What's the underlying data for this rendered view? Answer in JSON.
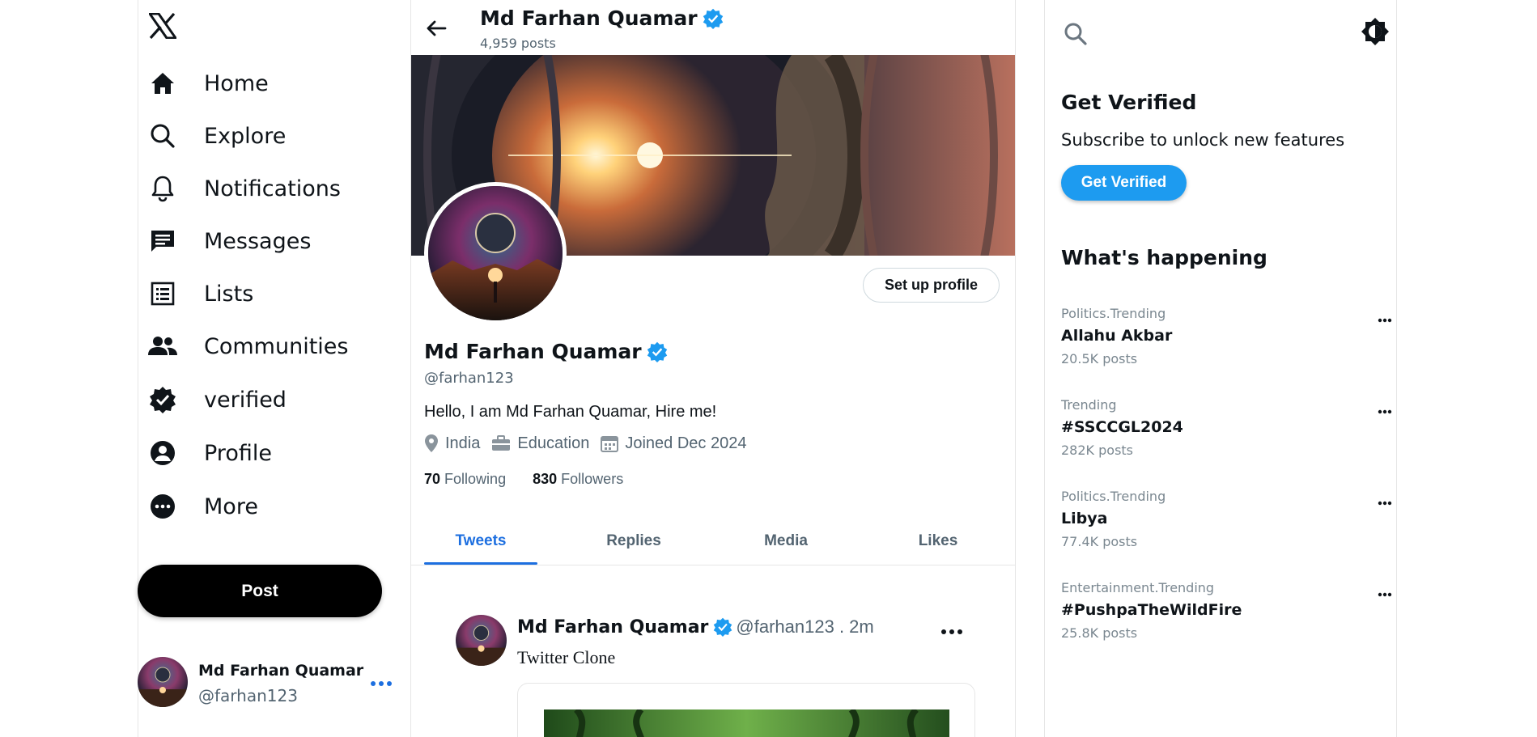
{
  "nav": {
    "items": [
      {
        "label": "Home",
        "icon": "home-icon"
      },
      {
        "label": "Explore",
        "icon": "search-icon"
      },
      {
        "label": "Notifications",
        "icon": "bell-icon"
      },
      {
        "label": "Messages",
        "icon": "message-icon"
      },
      {
        "label": "Lists",
        "icon": "list-icon"
      },
      {
        "label": "Communities",
        "icon": "people-icon"
      },
      {
        "label": "verified",
        "icon": "verified-badge-icon"
      },
      {
        "label": "Profile",
        "icon": "person-icon"
      },
      {
        "label": "More",
        "icon": "more-circle-icon"
      }
    ],
    "post_label": "Post"
  },
  "account": {
    "name": "Md Farhan Quamar",
    "handle": "@farhan123"
  },
  "profile": {
    "name": "Md Farhan Quamar",
    "posts_count": "4,959 posts",
    "handle": "@farhan123",
    "bio": "Hello, I am Md Farhan Quamar, Hire me!",
    "location": "India",
    "work": "Education",
    "joined": "Joined Dec 2024",
    "following_count": "70",
    "following_label": "Following",
    "followers_count": "830",
    "followers_label": "Followers",
    "setup_button": "Set up profile"
  },
  "tabs": [
    {
      "label": "Tweets",
      "active": true
    },
    {
      "label": "Replies",
      "active": false
    },
    {
      "label": "Media",
      "active": false
    },
    {
      "label": "Likes",
      "active": false
    }
  ],
  "tweet": {
    "name": "Md Farhan Quamar",
    "meta": "@farhan123 . 2m",
    "text": "Twitter Clone"
  },
  "right": {
    "verify_title": "Get Verified",
    "verify_subtitle": "Subscribe to unlock new features",
    "verify_button": "Get Verified",
    "happening_title": "What's happening",
    "trends": [
      {
        "category": "Politics.Trending",
        "title": "Allahu Akbar",
        "count": "20.5K posts"
      },
      {
        "category": "Trending",
        "title": "#SSCCGL2024",
        "count": "282K posts"
      },
      {
        "category": "Politics.Trending",
        "title": "Libya",
        "count": "77.4K posts"
      },
      {
        "category": "Entertainment.Trending",
        "title": "#PushpaTheWildFire",
        "count": "25.8K posts"
      }
    ]
  },
  "colors": {
    "accent": "#1d9bf0",
    "tab_active": "#1d6fe0",
    "verified": "#1d9bf0"
  }
}
